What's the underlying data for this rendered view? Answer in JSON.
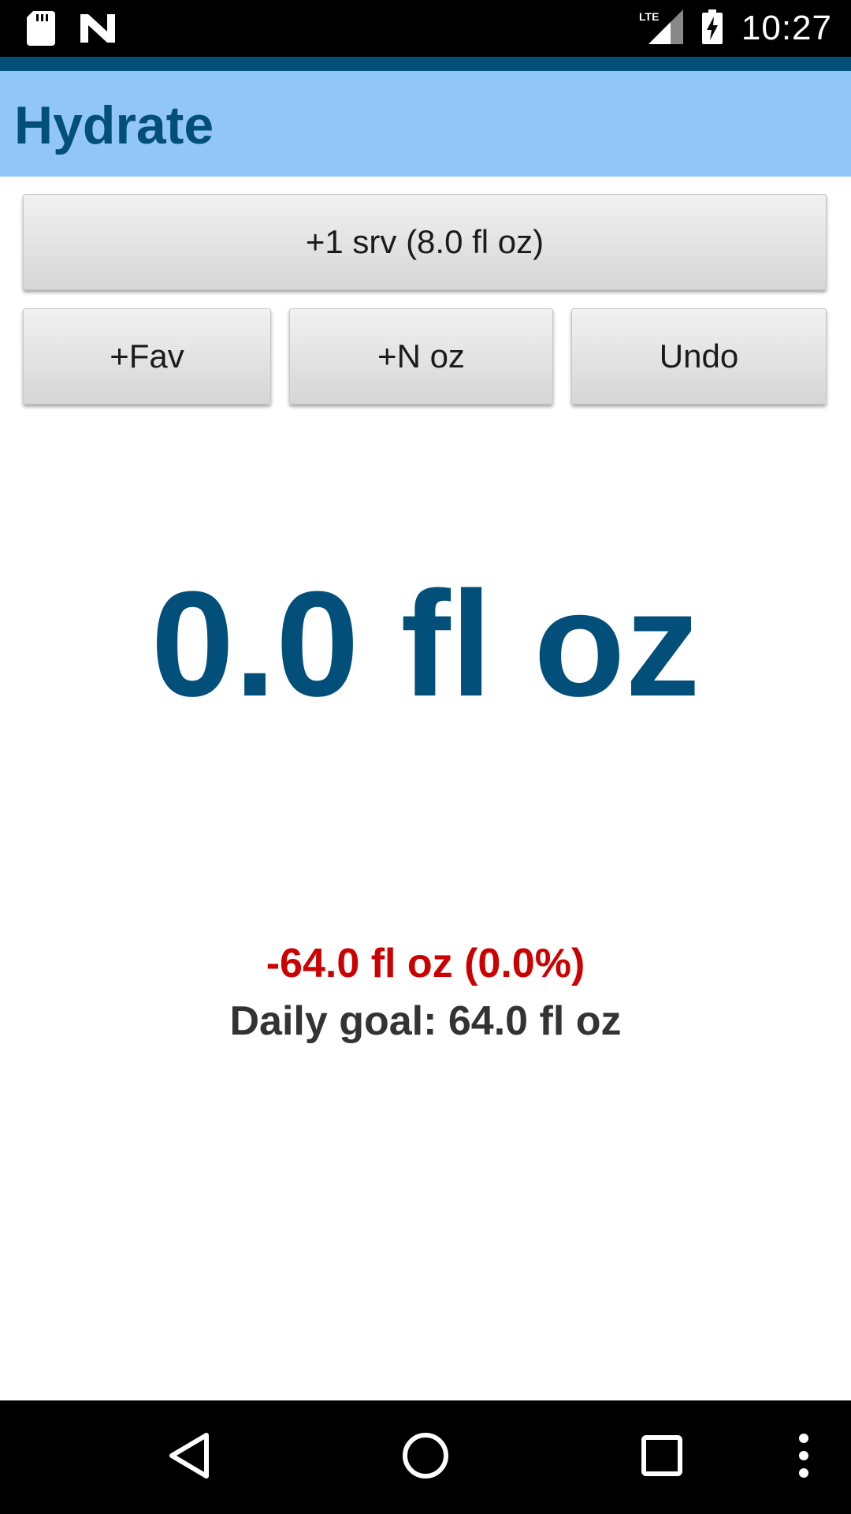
{
  "status_bar": {
    "time": "10:27",
    "network": "LTE",
    "icons": [
      "sd-card-icon",
      "n-logo-icon",
      "lte-signal-icon",
      "battery-charging-icon"
    ]
  },
  "app_bar": {
    "title": "Hydrate"
  },
  "actions": {
    "add_serving_label": "+1 srv (8.0 fl oz)",
    "add_favorite_label": "+Fav",
    "add_n_oz_label": "+N oz",
    "undo_label": "Undo"
  },
  "intake": {
    "total": "0.0 fl oz",
    "remaining": "-64.0 fl oz (0.0%)",
    "daily_goal": "Daily goal: 64.0 fl oz"
  },
  "colors": {
    "accent_dark": "#02507A",
    "app_bar": "#93C6F8",
    "deficit_red": "#CC0000"
  },
  "nav_bar": {
    "icons": [
      "back-icon",
      "home-icon",
      "recents-icon",
      "overflow-menu-icon"
    ]
  }
}
